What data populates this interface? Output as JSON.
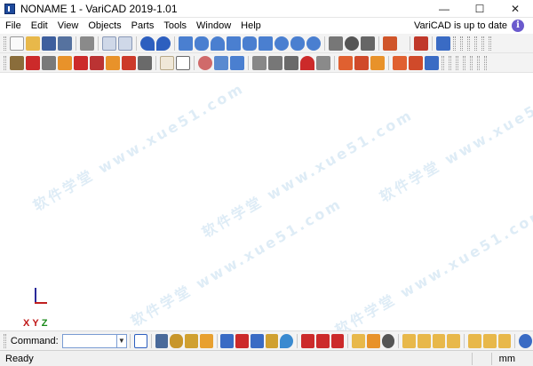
{
  "window": {
    "title": "NONAME 1 - VariCAD 2019-1.01",
    "minimize": "—",
    "maximize": "☐",
    "close": "✕"
  },
  "menu": {
    "items": [
      "File",
      "Edit",
      "View",
      "Objects",
      "Parts",
      "Tools",
      "Window",
      "Help"
    ],
    "update_status": "VariCAD is up to date",
    "info_icon": "i"
  },
  "canvas": {
    "watermark": "软件学堂 www.xue51.com",
    "axes": {
      "x": "X",
      "y": "Y",
      "z": "Z"
    }
  },
  "command": {
    "label": "Command:",
    "value": "",
    "dropdown": "▼"
  },
  "status": {
    "text": "Ready",
    "unit": "mm"
  },
  "colors": {
    "toolbar_bg": "#f3f3f3",
    "accent_blue": "#3b6fc8",
    "accent_red": "#cc2a2a",
    "accent_orange": "#e8922a"
  }
}
